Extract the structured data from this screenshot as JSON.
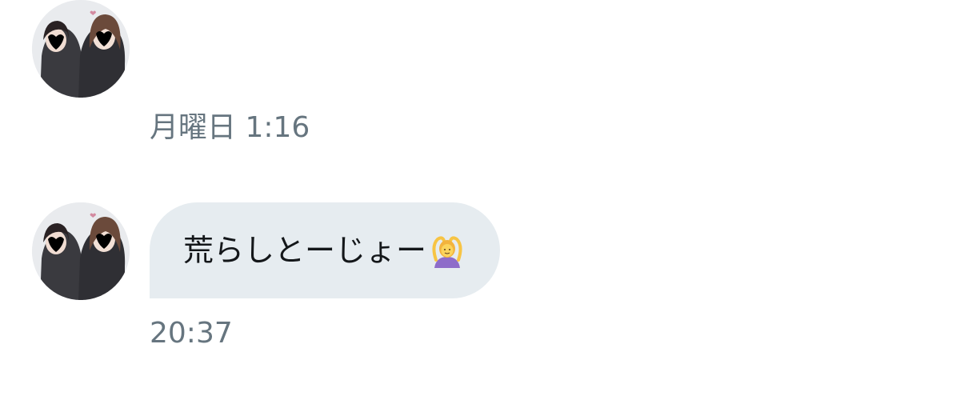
{
  "thread": {
    "messages": [
      {
        "avatar_icon": "profile-photo-icon",
        "timestamp": "月曜日 1:16"
      },
      {
        "avatar_icon": "profile-photo-icon",
        "text": "荒らしとーじょー",
        "emoji_icon": "person-gesturing-ok-icon",
        "timestamp": "20:37"
      }
    ]
  },
  "colors": {
    "bubble_background": "#e6ecf0",
    "message_text": "#14171a",
    "timestamp_text": "#66757f",
    "background": "#ffffff"
  }
}
